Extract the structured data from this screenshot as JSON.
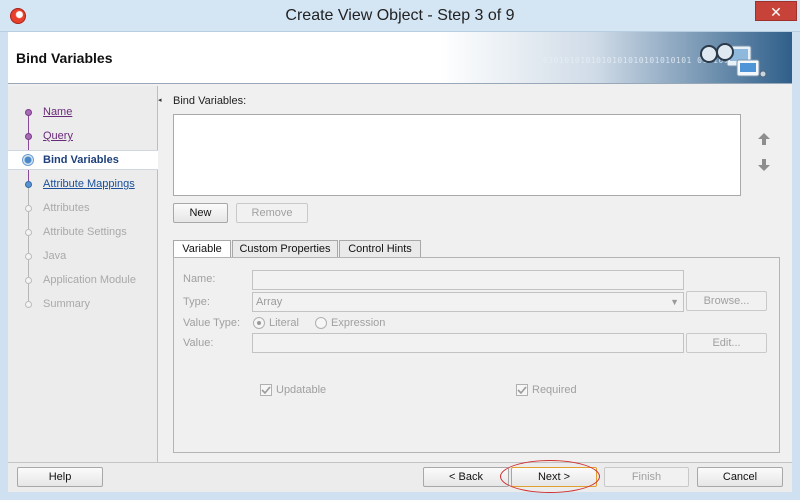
{
  "window": {
    "title": "Create View Object - Step 3 of 9",
    "close_glyph": "✕",
    "app_icon": "oracle-jdev-icon"
  },
  "header": {
    "title": "Bind Variables",
    "binary_text": "0101010101010101010101010101 0101010101",
    "graphic_icon": "glasses-monitor-icon"
  },
  "nav": {
    "items": [
      {
        "label": "Name",
        "state": "done"
      },
      {
        "label": "Query",
        "state": "done"
      },
      {
        "label": "Bind Variables",
        "state": "current"
      },
      {
        "label": "Attribute Mappings",
        "state": "next"
      },
      {
        "label": "Attributes",
        "state": "pending"
      },
      {
        "label": "Attribute Settings",
        "state": "pending"
      },
      {
        "label": "Java",
        "state": "pending"
      },
      {
        "label": "Application Module",
        "state": "pending"
      },
      {
        "label": "Summary",
        "state": "pending"
      }
    ]
  },
  "main": {
    "bind_label": "Bind Variables:",
    "move_up_icon": "arrow-up-icon",
    "move_down_icon": "arrow-down-icon",
    "new_button": "New",
    "remove_button": "Remove",
    "tabs": [
      {
        "label": "Variable",
        "active": true
      },
      {
        "label": "Custom Properties",
        "active": false
      },
      {
        "label": "Control Hints",
        "active": false
      }
    ],
    "form": {
      "name_label": "Name:",
      "name_value": "",
      "type_label": "Type:",
      "type_value": "Array",
      "browse_button": "Browse...",
      "value_type_label": "Value Type:",
      "literal_label": "Literal",
      "expression_label": "Expression",
      "value_type_selected": "Literal",
      "value_label": "Value:",
      "value_value": "",
      "edit_button": "Edit...",
      "updatable_label": "Updatable",
      "updatable_checked": true,
      "required_label": "Required",
      "required_checked": true
    }
  },
  "footer": {
    "help": "Help",
    "back": "< Back",
    "next": "Next >",
    "finish": "Finish",
    "cancel": "Cancel"
  },
  "colors": {
    "title_bar": "#d4e5f4",
    "close_button": "#c7433a",
    "nav_done": "#6a2a7a",
    "nav_current": "#1d3f7a",
    "annotation_ring": "#d03030"
  }
}
